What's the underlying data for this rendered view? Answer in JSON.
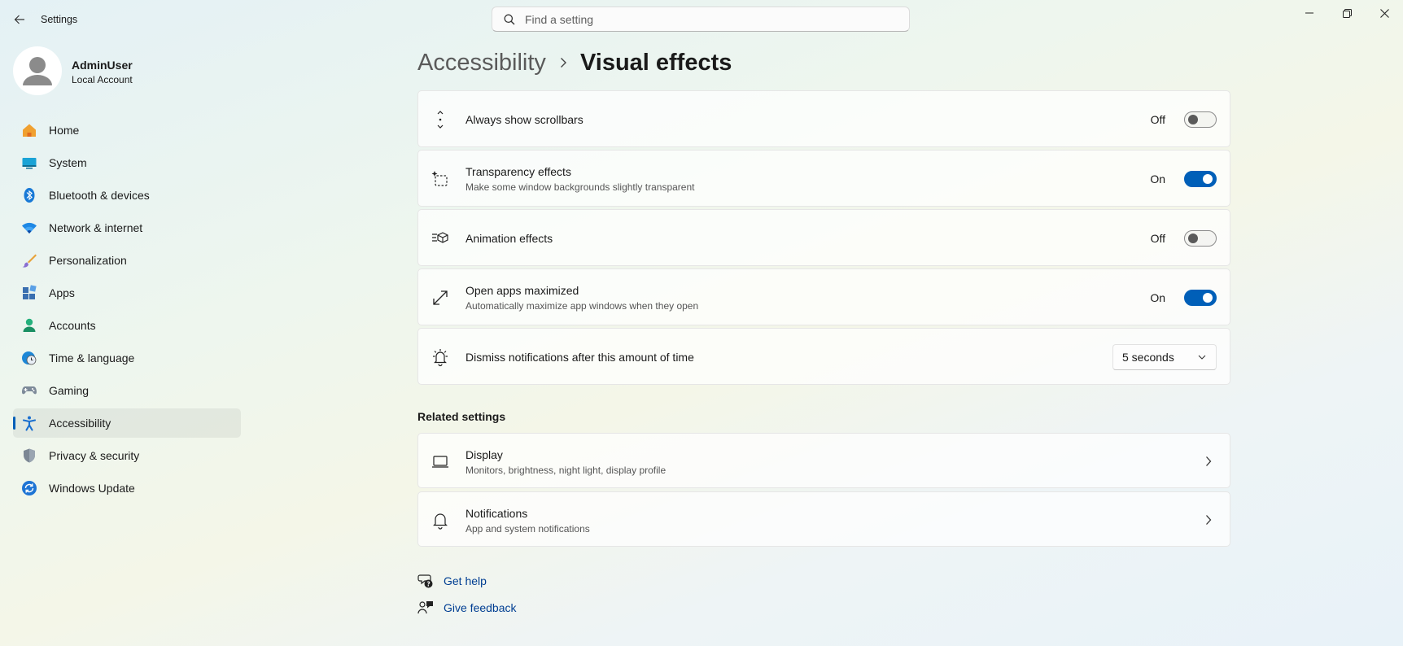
{
  "app": {
    "title": "Settings"
  },
  "search": {
    "placeholder": "Find a setting"
  },
  "profile": {
    "name": "AdminUser",
    "account_type": "Local Account"
  },
  "nav": {
    "items": [
      {
        "label": "Home",
        "icon": "home-icon"
      },
      {
        "label": "System",
        "icon": "system-icon"
      },
      {
        "label": "Bluetooth & devices",
        "icon": "bluetooth-icon"
      },
      {
        "label": "Network & internet",
        "icon": "wifi-icon"
      },
      {
        "label": "Personalization",
        "icon": "brush-icon"
      },
      {
        "label": "Apps",
        "icon": "apps-icon"
      },
      {
        "label": "Accounts",
        "icon": "accounts-icon"
      },
      {
        "label": "Time & language",
        "icon": "globe-clock-icon"
      },
      {
        "label": "Gaming",
        "icon": "gamepad-icon"
      },
      {
        "label": "Accessibility",
        "icon": "accessibility-icon",
        "active": true
      },
      {
        "label": "Privacy & security",
        "icon": "shield-icon"
      },
      {
        "label": "Windows Update",
        "icon": "update-icon"
      }
    ]
  },
  "breadcrumb": {
    "parent": "Accessibility",
    "current": "Visual effects"
  },
  "settings": [
    {
      "title": "Always show scrollbars",
      "state_text": "Off",
      "on": false,
      "icon": "scrollbars-icon"
    },
    {
      "title": "Transparency effects",
      "description": "Make some window backgrounds slightly transparent",
      "state_text": "On",
      "on": true,
      "icon": "transparency-icon"
    },
    {
      "title": "Animation effects",
      "state_text": "Off",
      "on": false,
      "icon": "animation-icon"
    },
    {
      "title": "Open apps maximized",
      "description": "Automatically maximize app windows when they open",
      "state_text": "On",
      "on": true,
      "icon": "maximize-icon"
    },
    {
      "title": "Dismiss notifications after this amount of time",
      "selected": "5 seconds",
      "icon": "notification-timer-icon"
    }
  ],
  "related": {
    "title": "Related settings",
    "items": [
      {
        "title": "Display",
        "description": "Monitors, brightness, night light, display profile",
        "icon": "laptop-icon"
      },
      {
        "title": "Notifications",
        "description": "App and system notifications",
        "icon": "bell-icon"
      }
    ]
  },
  "help": {
    "get_help": "Get help",
    "give_feedback": "Give feedback"
  },
  "colors": {
    "accent": "#005fb8",
    "link": "#003e92"
  }
}
